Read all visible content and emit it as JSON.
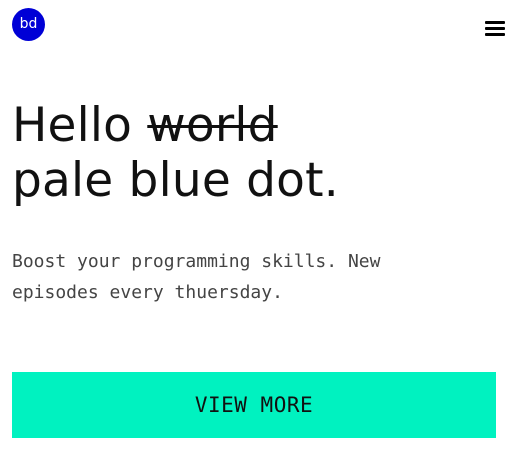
{
  "header": {
    "avatar_initials": "bd",
    "avatar_color": "#0000d6",
    "menu_icon": "hamburger-menu-icon"
  },
  "hero": {
    "headline_word_1": "Hello",
    "headline_struck_word": "world",
    "headline_line_2": "pale blue dot.",
    "subtext": "Boost your programming skills. New episodes every thuersday."
  },
  "cta": {
    "label": "VIEW MORE",
    "color": "#00f2c0"
  }
}
